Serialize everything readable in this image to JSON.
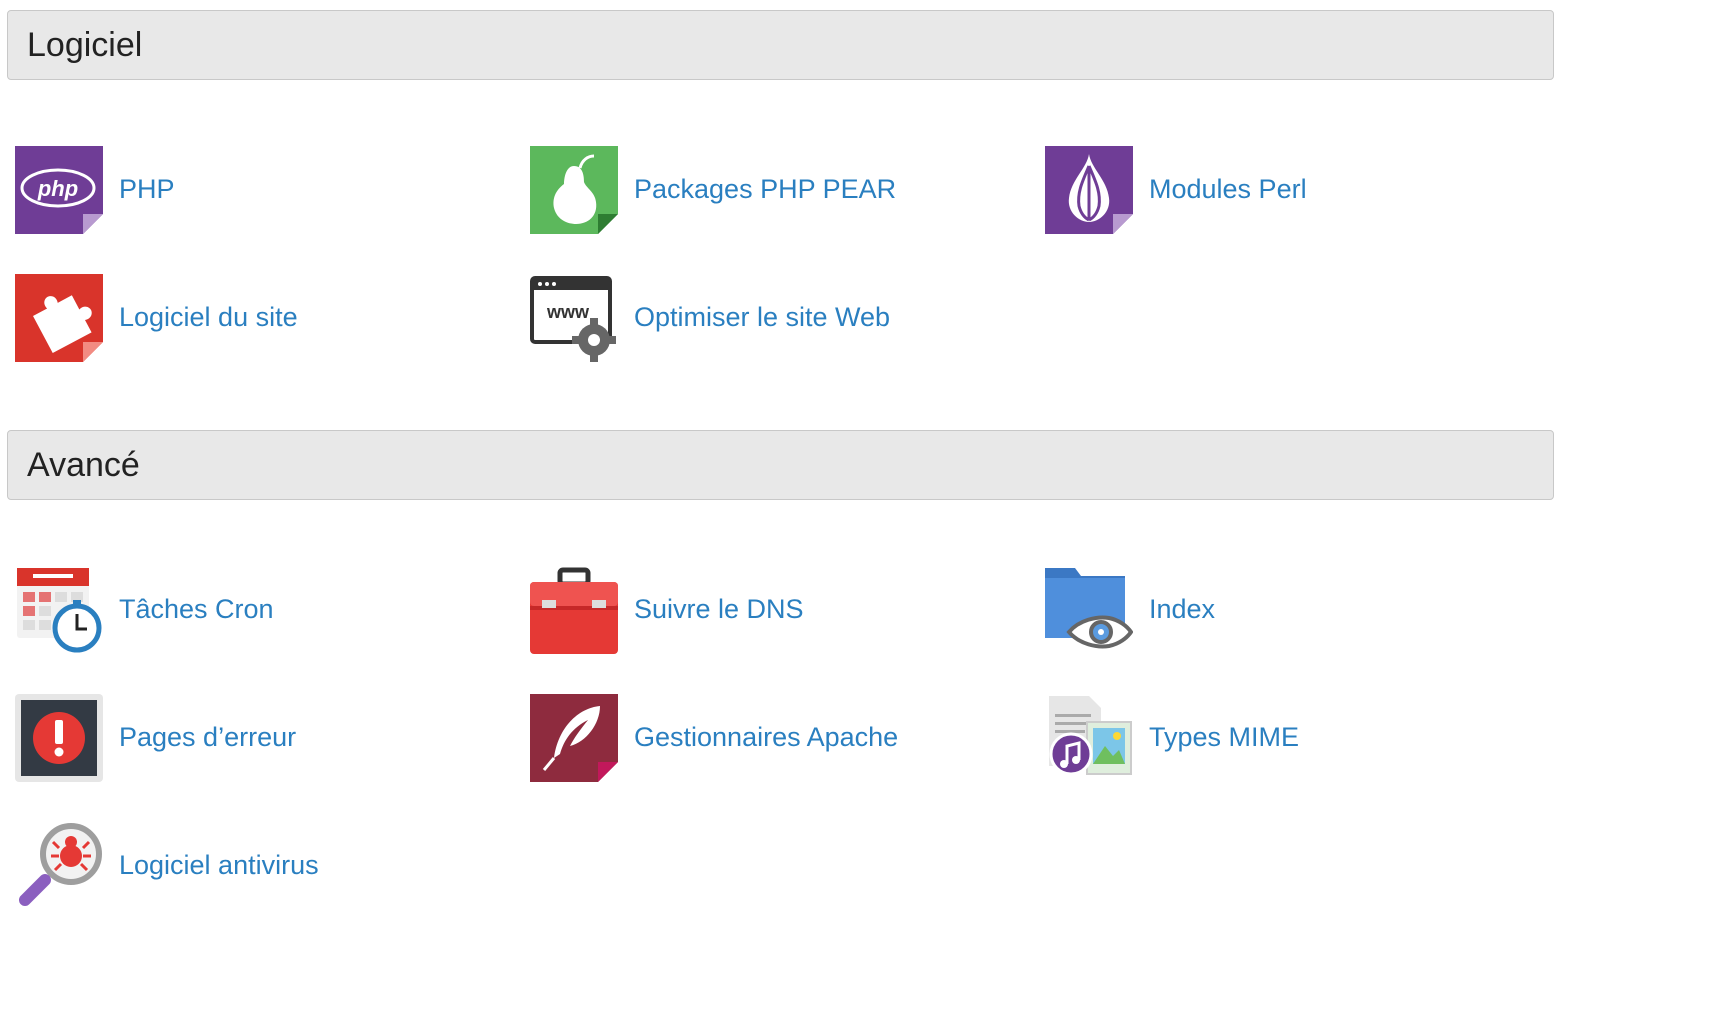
{
  "sections": [
    {
      "title": "Logiciel",
      "items": [
        {
          "label": "PHP",
          "icon": "php-icon"
        },
        {
          "label": "Packages PHP PEAR",
          "icon": "pear-icon"
        },
        {
          "label": "Modules Perl",
          "icon": "onion-icon"
        },
        {
          "label": "Logiciel du site",
          "icon": "puzzle-icon"
        },
        {
          "label": "Optimiser le site Web",
          "icon": "www-gear-icon"
        }
      ]
    },
    {
      "title": "Avancé",
      "items": [
        {
          "label": "Tâches Cron",
          "icon": "calendar-clock-icon"
        },
        {
          "label": "Suivre le DNS",
          "icon": "toolbox-icon"
        },
        {
          "label": "Index",
          "icon": "folder-eye-icon"
        },
        {
          "label": "Pages d’erreur",
          "icon": "error-page-icon"
        },
        {
          "label": "Gestionnaires Apache",
          "icon": "feather-icon"
        },
        {
          "label": "Types MIME",
          "icon": "mime-files-icon"
        },
        {
          "label": "Logiciel antivirus",
          "icon": "virus-search-icon"
        }
      ]
    }
  ],
  "icon_text": {
    "php": "php",
    "www": "www"
  },
  "colors": {
    "link": "#2a7fc0",
    "header_bg": "#e8e8e8",
    "purple": "#6f3d96",
    "green": "#5cb85c",
    "red": "#d9342b",
    "maroon": "#8e2b3e"
  }
}
